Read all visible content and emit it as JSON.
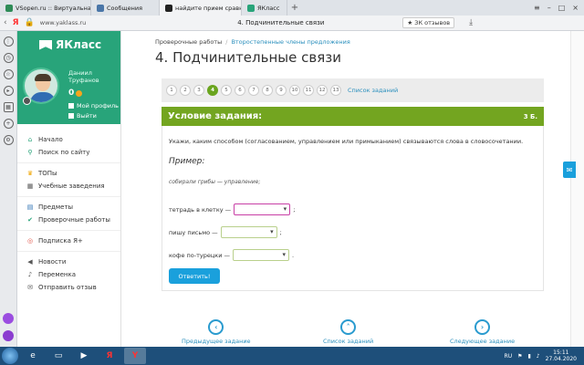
{
  "browser": {
    "tabs": [
      {
        "label": "VSopen.ru :: Виртуальная",
        "color": "#2e8b57",
        "active": false
      },
      {
        "label": "Сообщения",
        "color": "#4a76a8",
        "active": false
      },
      {
        "label": "найдите прием сравнения",
        "color": "#222222",
        "active": true
      },
      {
        "label": "ЯКласс",
        "color": "#28a47a",
        "active": false
      }
    ],
    "new_tab": "+",
    "url": "www.yaklass.ru",
    "page_title": "4. Подчинительные связи",
    "reviews": "★ ЗК отзывов"
  },
  "site": {
    "logo": "ЯКласс",
    "user": {
      "first": "Даниил",
      "last": "Труфанов",
      "points": "0"
    },
    "profile_link": "Мой профиль",
    "logout_link": "Выйти",
    "menu": [
      [
        {
          "label": "Начало",
          "icon": "home-icon"
        },
        {
          "label": "Поиск по сайту",
          "icon": "search-icon"
        }
      ],
      [
        {
          "label": "ТОПы",
          "icon": "trophy-icon"
        },
        {
          "label": "Учебные заведения",
          "icon": "school-icon"
        }
      ],
      [
        {
          "label": "Предметы",
          "icon": "subjects-icon"
        },
        {
          "label": "Проверочные работы",
          "icon": "check-icon"
        }
      ],
      [
        {
          "label": "Подписка Я+",
          "icon": "subscription-icon"
        }
      ],
      [
        {
          "label": "Новости",
          "icon": "news-icon"
        },
        {
          "label": "Переменка",
          "icon": "bell-icon"
        },
        {
          "label": "Отправить отзыв",
          "icon": "feedback-icon"
        }
      ]
    ]
  },
  "main": {
    "breadcrumb": {
      "root": "Проверочные работы",
      "current": "Второстепенные члены предложения"
    },
    "title": "4. Подчинительные связи",
    "pages": [
      "1",
      "2",
      "3",
      "4",
      "5",
      "6",
      "7",
      "8",
      "9",
      "10",
      "11",
      "12",
      "13"
    ],
    "active_page": "4",
    "all_tasks": "Список заданий",
    "task_header": "Условие задания:",
    "score": "3 Б.",
    "question": "Укажи, каким способом (согласованием, управлением или примыканием) связываются слова в словосочетании.",
    "example_label": "Пример:",
    "example_text": "собирали грибы — управление;",
    "rows": [
      {
        "phrase": "тетрадь в клетку —",
        "end": ";"
      },
      {
        "phrase": "пишу письмо —",
        "end": ";"
      },
      {
        "phrase": "кофе по-турецки —",
        "end": "."
      }
    ],
    "answer_button": "Ответить!",
    "prev": "Предыдущее задание",
    "list": "Список заданий",
    "next": "Следующее задание"
  },
  "system": {
    "lang": "RU",
    "time": "15:11",
    "date": "27.04.2020"
  }
}
